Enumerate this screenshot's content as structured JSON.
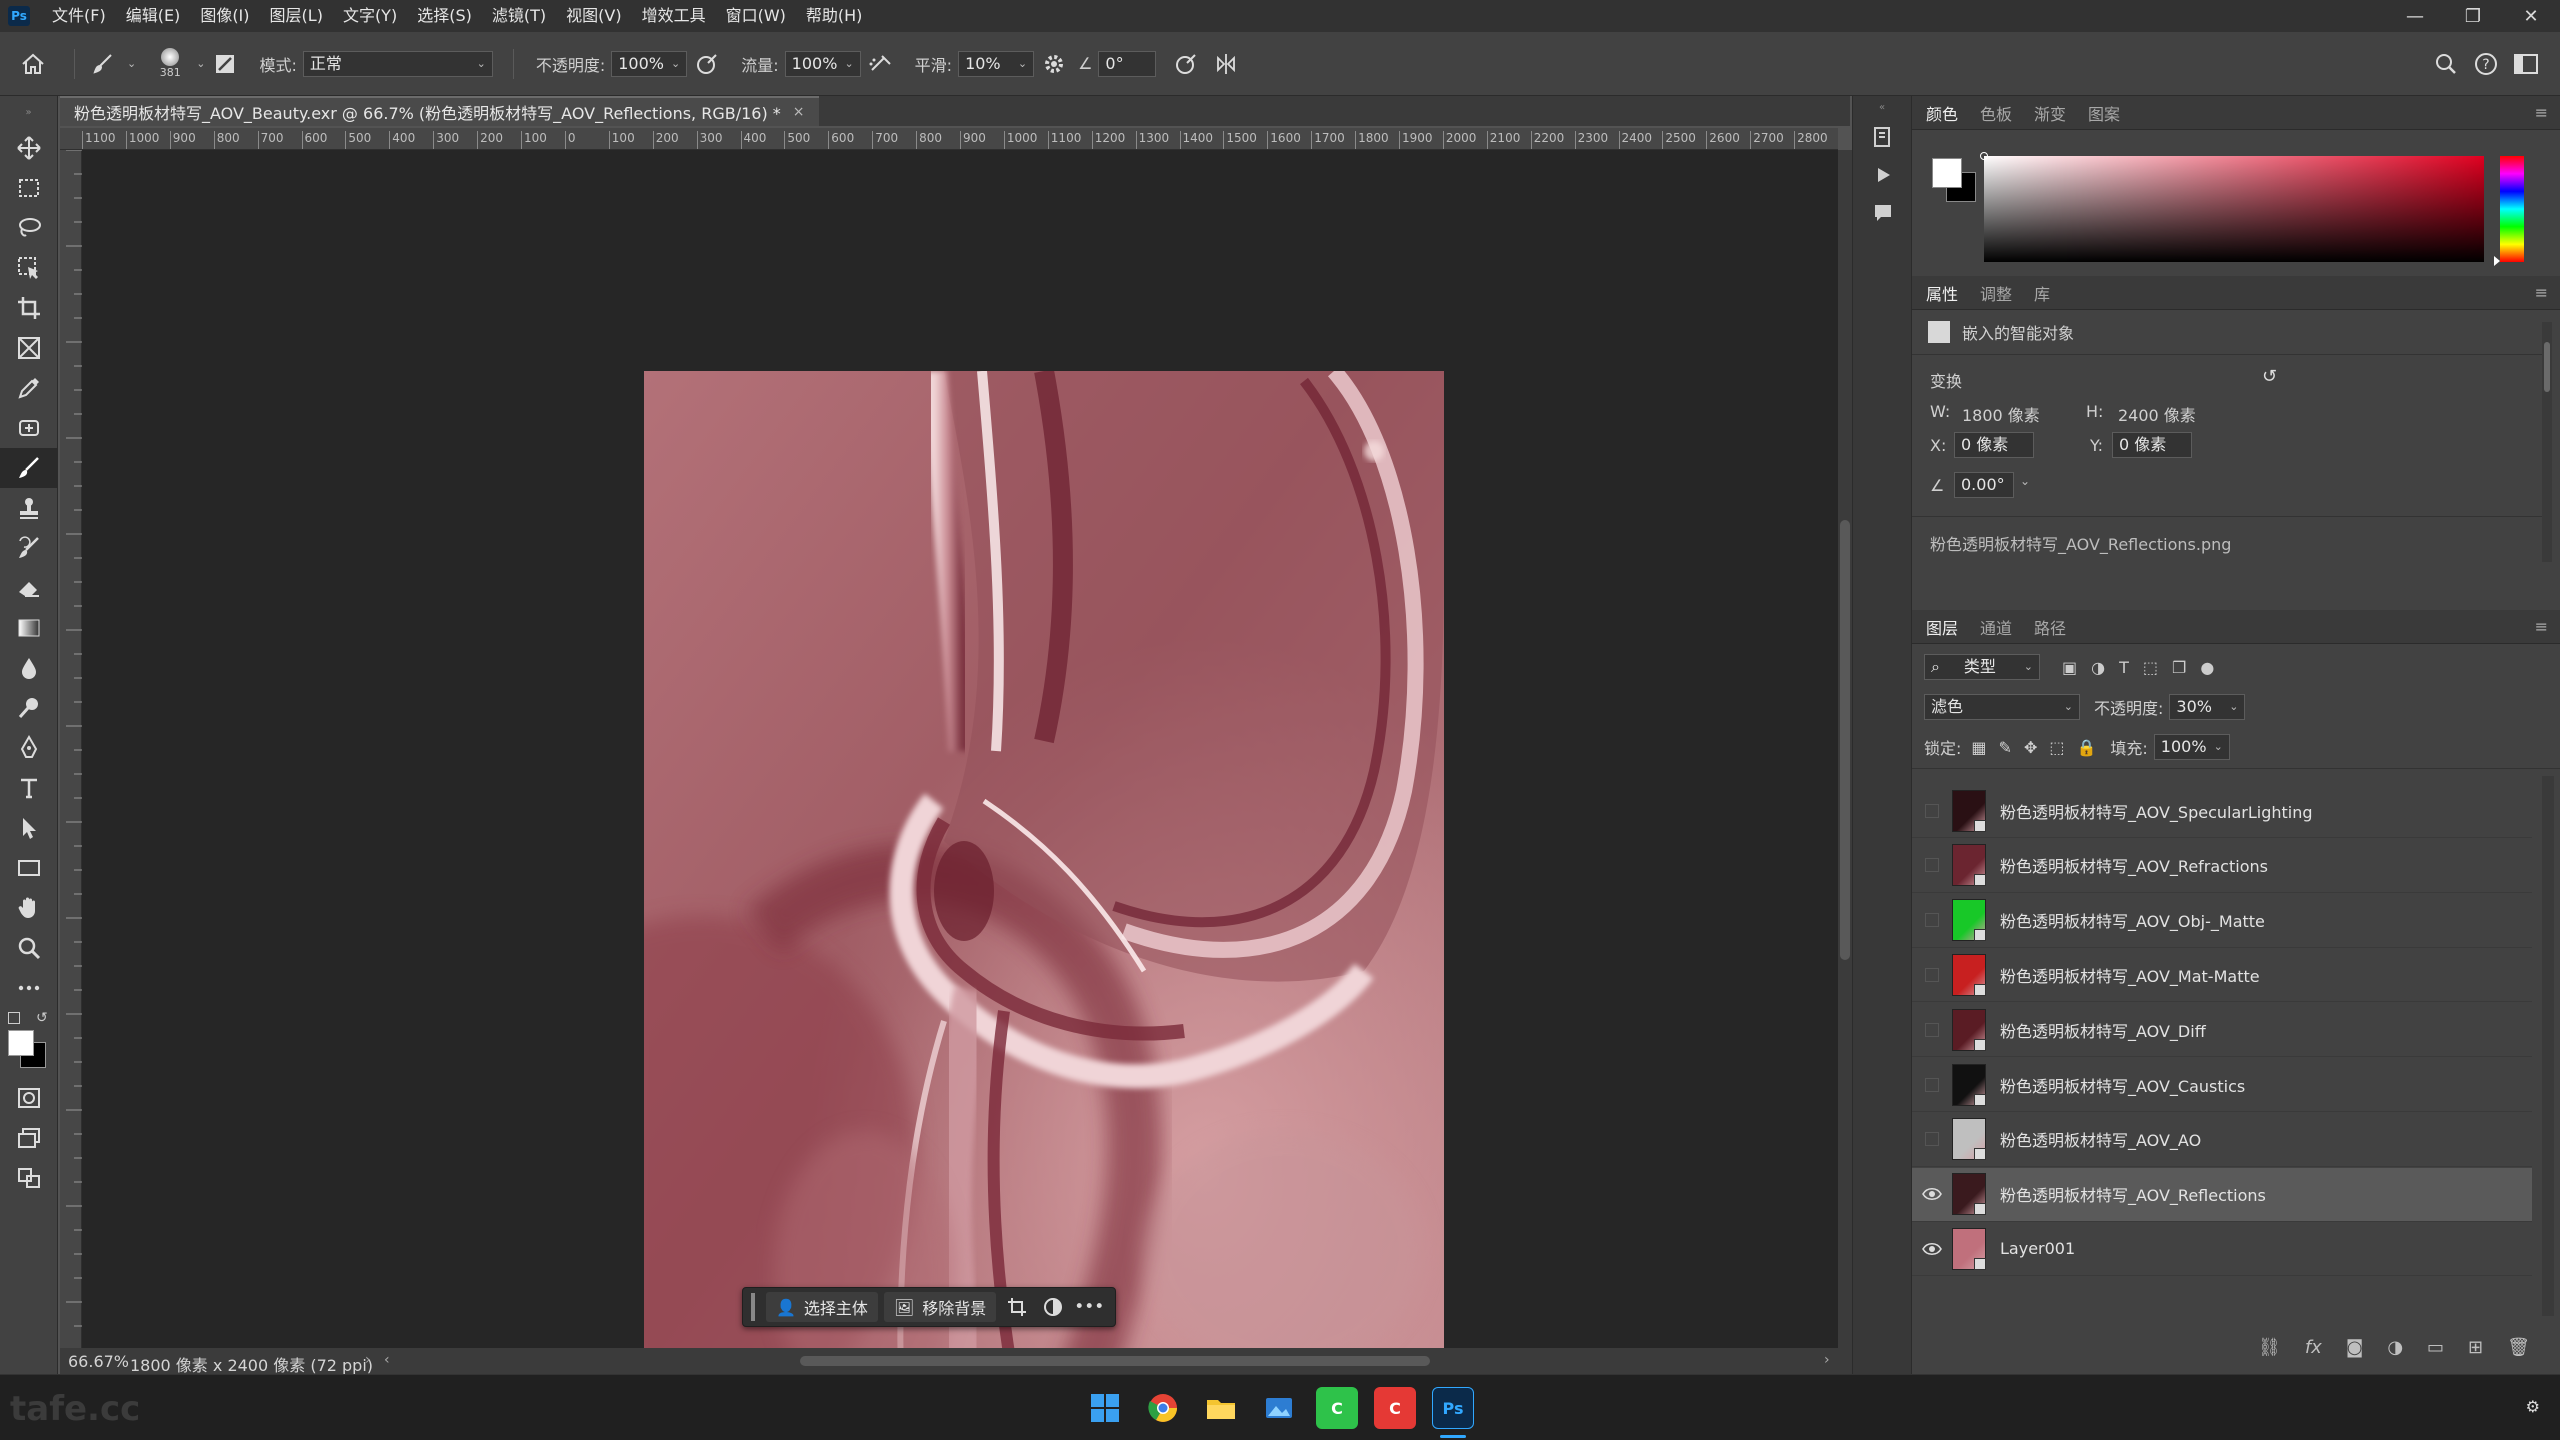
{
  "menu": [
    "文件(F)",
    "编辑(E)",
    "图像(I)",
    "图层(L)",
    "文字(Y)",
    "选择(S)",
    "滤镜(T)",
    "视图(V)",
    "增效工具",
    "窗口(W)",
    "帮助(H)"
  ],
  "app_logo": "Ps",
  "window_controls": {
    "minimize": "—",
    "maximize": "❐",
    "close": "✕"
  },
  "options": {
    "brush_size": "381",
    "mode_label": "模式:",
    "mode_value": "正常",
    "opacity_label": "不透明度:",
    "opacity_value": "100%",
    "flow_label": "流量:",
    "flow_value": "100%",
    "smooth_label": "平滑:",
    "smooth_value": "10%",
    "angle_value": "0°"
  },
  "document": {
    "tab_title": "粉色透明板材特写_AOV_Beauty.exr @ 66.7% (粉色透明板材特写_AOV_Reflections, RGB/16) *",
    "close": "×"
  },
  "ruler_top_labels": [
    "1100",
    "1000",
    "900",
    "800",
    "700",
    "600",
    "500",
    "400",
    "300",
    "200",
    "100",
    "0",
    "100",
    "200",
    "300",
    "400",
    "500",
    "600",
    "700",
    "800",
    "900",
    "1000",
    "1100",
    "1200",
    "1300",
    "1400",
    "1500",
    "1600",
    "1700",
    "1800",
    "1900",
    "2000",
    "2100",
    "2200",
    "2300",
    "2400",
    "2500",
    "2600",
    "2700",
    "2800"
  ],
  "context_bar": {
    "select_subject": "选择主体",
    "remove_bg": "移除背景",
    "more": "•••"
  },
  "status": {
    "zoom": "66.67%",
    "info": "1800 像素 x 2400 像素 (72 ppi)"
  },
  "color_panel": {
    "tabs": [
      "颜色",
      "色板",
      "渐变",
      "图案"
    ],
    "active": 0
  },
  "properties_panel": {
    "tabs": [
      "属性",
      "调整",
      "库"
    ],
    "object_type": "嵌入的智能对象",
    "transform_label": "变换",
    "w_label": "W:",
    "w_value": "1800 像素",
    "h_label": "H:",
    "h_value": "2400 像素",
    "x_label": "X:",
    "x_value": "0 像素",
    "y_label": "Y:",
    "y_value": "0 像素",
    "angle_value": "0.00°",
    "filename": "粉色透明板材特写_AOV_Reflections.png"
  },
  "layers_panel": {
    "tabs": [
      "图层",
      "通道",
      "路径"
    ],
    "filter_label": "类型",
    "blend_mode": "滤色",
    "opacity_label": "不透明度:",
    "opacity_value": "30%",
    "lock_label": "锁定:",
    "fill_label": "填充:",
    "fill_value": "100%",
    "layers": [
      {
        "name": "粉色透明板材特写_AOV_SpecularLighting",
        "visible": false,
        "selected": false,
        "thumb": "#2a1014"
      },
      {
        "name": "粉色透明板材特写_AOV_Refractions",
        "visible": false,
        "selected": false,
        "thumb": "#6b2530"
      },
      {
        "name": "粉色透明板材特写_AOV_Obj-_Matte",
        "visible": false,
        "selected": false,
        "thumb": "#18c828"
      },
      {
        "name": "粉色透明板材特写_AOV_Mat-Matte",
        "visible": false,
        "selected": false,
        "thumb": "#c82020"
      },
      {
        "name": "粉色透明板材特写_AOV_Diff",
        "visible": false,
        "selected": false,
        "thumb": "#5a1c24"
      },
      {
        "name": "粉色透明板材特写_AOV_Caustics",
        "visible": false,
        "selected": false,
        "thumb": "#111111"
      },
      {
        "name": "粉色透明板材特写_AOV_AO",
        "visible": false,
        "selected": false,
        "thumb": "#bfbfbf"
      },
      {
        "name": "粉色透明板材特写_AOV_Reflections",
        "visible": true,
        "selected": true,
        "thumb": "#3a1a1e"
      },
      {
        "name": "Layer001",
        "visible": true,
        "selected": false,
        "thumb": "#c0707c"
      }
    ],
    "footer_icons": [
      "link-icon",
      "fx-icon",
      "mask-icon",
      "adjustment-icon",
      "folder-icon",
      "new-layer-icon",
      "trash-icon"
    ]
  },
  "taskbar": {
    "watermark": "tafe.cc",
    "apps": [
      "windows-icon",
      "chrome-icon",
      "explorer-icon",
      "photos-icon",
      "app-green-icon",
      "app-red-icon",
      "photoshop-icon"
    ]
  },
  "colors": {
    "accent": "#31a8ff",
    "panel_bg": "#424242",
    "canvas_bg": "#262626"
  }
}
